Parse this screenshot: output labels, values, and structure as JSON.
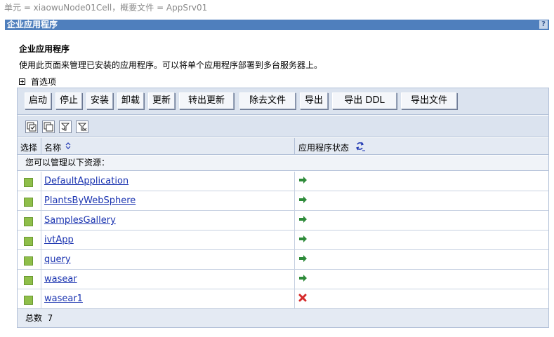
{
  "scope": "单元  = xiaowuNode01Cell，概要文件  = AppSrv01",
  "portlet_title": "企业应用程序",
  "help_icon": "?",
  "heading": "企业应用程序",
  "description": "使用此页面来管理已安装的应用程序。可以将单个应用程序部署到多台服务器上。",
  "preferences_label": "首选项",
  "buttons": [
    "启动",
    "停止",
    "安装",
    "卸载",
    "更新",
    "转出更新",
    "除去文件",
    "导出",
    "导出  DDL",
    "导出文件"
  ],
  "tool_icons": [
    "select-all-icon",
    "deselect-all-icon",
    "show-filter-icon",
    "clear-filter-icon"
  ],
  "columns": {
    "select": "选择",
    "name": "名称",
    "status": "应用程序状态"
  },
  "resources_label": "您可以管理以下资源：",
  "apps": [
    {
      "name": "DefaultApplication",
      "status": "started"
    },
    {
      "name": "PlantsByWebSphere",
      "status": "started"
    },
    {
      "name": "SamplesGallery",
      "status": "started"
    },
    {
      "name": "ivtApp",
      "status": "started"
    },
    {
      "name": "query",
      "status": "started"
    },
    {
      "name": "wasear",
      "status": "started"
    },
    {
      "name": "wasear1",
      "status": "stopped"
    }
  ],
  "total_label": "总数",
  "total_count": "7",
  "colors": {
    "title_bar": "#4f7fbd",
    "link": "#1a33b0",
    "started": "#2e8b3a",
    "stopped": "#d62b2b",
    "checkbox": "#8fbe4a"
  }
}
